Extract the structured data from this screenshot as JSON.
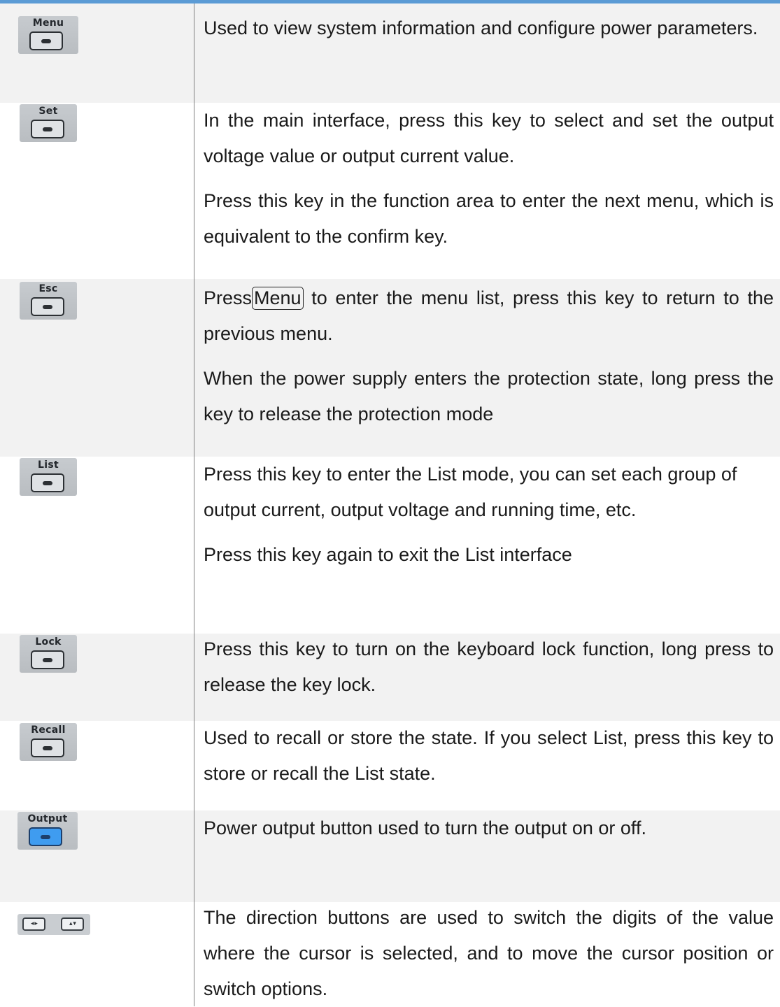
{
  "rows": [
    {
      "key_label": "Menu",
      "paragraphs": [
        "Used to view system information and configure power parameters."
      ]
    },
    {
      "key_label": "Set",
      "paragraphs": [
        "In the main interface, press this key to select and set the output voltage value or output current value.",
        "Press this key in the function area to enter the next menu, which is equivalent to the confirm key."
      ]
    },
    {
      "key_label": "Esc",
      "para1_before": "Press",
      "para1_key": "Menu",
      "para1_after": " to enter the menu list, press this key to return to the previous menu.",
      "paragraphs": [
        "",
        "When the power supply enters the protection state, long press the key to release the protection mode"
      ]
    },
    {
      "key_label": "List",
      "paragraphs": [
        "Press this key to enter the List mode, you can set each group of output current, output voltage and running time, etc.",
        "Press this key again to exit the List interface"
      ]
    },
    {
      "key_label": "Lock",
      "paragraphs": [
        "Press this key to turn on the keyboard lock function, long press to release the key lock."
      ]
    },
    {
      "key_label": "Recall",
      "paragraphs": [
        "Used to recall or store the state. If you select List, press this key to store or recall the List state."
      ]
    },
    {
      "key_label": "Output",
      "paragraphs": [
        "Power output button used to turn the output on or off."
      ]
    },
    {
      "key_label": "",
      "arrows": [
        "◂ ▸",
        "▴ ▾"
      ],
      "paragraphs": [
        "The direction buttons are used to switch the digits of the value where the cursor is selected, and to move the cursor position or switch options."
      ]
    }
  ],
  "colors": {
    "top_rule": "#5b9bd5",
    "row_shade": "#f2f2f2",
    "output_key": "#3f9cf0"
  }
}
